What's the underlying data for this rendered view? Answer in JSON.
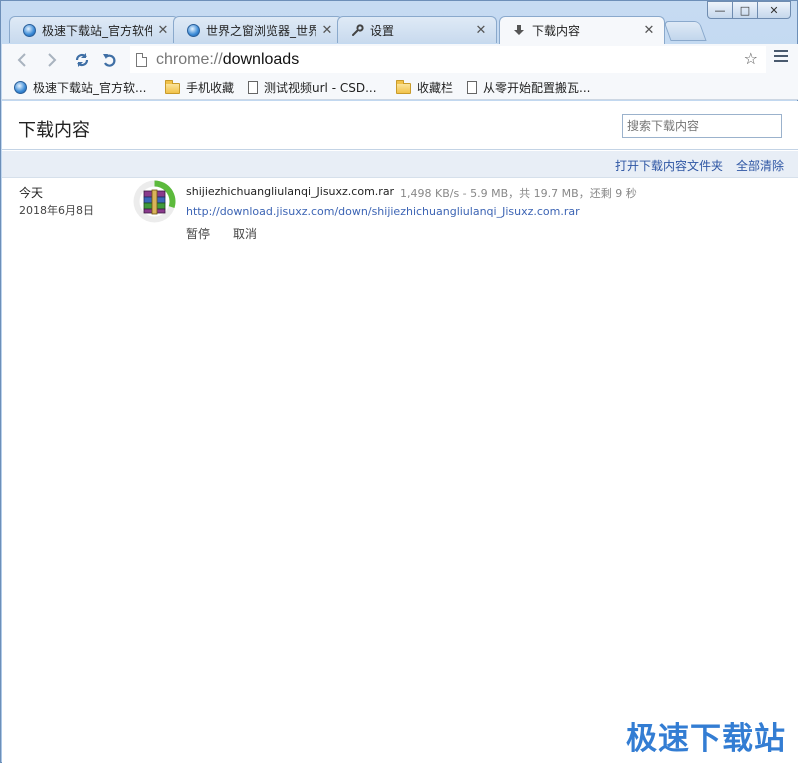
{
  "window": {
    "controls": [
      "minimize",
      "maximize",
      "close"
    ]
  },
  "tabs": [
    {
      "title": "极速下载站_官方软件",
      "icon": "globe-icon",
      "active": false
    },
    {
      "title": "世界之窗浏览器_世界",
      "icon": "globe-icon",
      "active": false
    },
    {
      "title": "设置",
      "icon": "wrench-icon",
      "active": false
    },
    {
      "title": "下载内容",
      "icon": "download-icon",
      "active": true
    }
  ],
  "toolbar": {
    "url_scheme": "chrome://",
    "url_host": "downloads"
  },
  "bookmarks": [
    {
      "label": "极速下载站_官方软...",
      "icon": "globe-icon"
    },
    {
      "label": "手机收藏",
      "icon": "folder-icon"
    },
    {
      "label": "测试视频url - CSD...",
      "icon": "page-icon"
    },
    {
      "label": "收藏栏",
      "icon": "folder-icon"
    },
    {
      "label": "从零开始配置搬瓦...",
      "icon": "page-icon"
    }
  ],
  "page": {
    "title": "下载内容",
    "search_placeholder": "搜索下载内容",
    "open_folder_label": "打开下载内容文件夹",
    "clear_all_label": "全部清除"
  },
  "download": {
    "day": "今天",
    "date": "2018年6月8日",
    "filename": "shijiezhichuangliulanqi_Jisuxz.com.rar",
    "status": "1,498 KB/s - 5.9 MB，共 19.7 MB，还剩 9 秒",
    "url": "http://download.jisuxz.com/down/shijiezhichuangliulanqi_Jisuxz.com.rar",
    "pause_label": "暂停",
    "cancel_label": "取消",
    "progress": 0.3
  },
  "watermark": "极速下载站"
}
